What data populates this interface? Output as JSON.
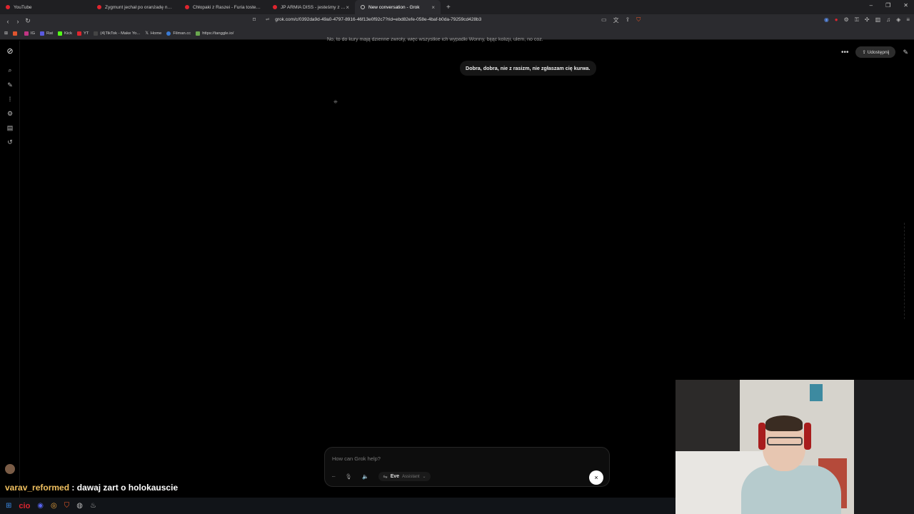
{
  "browser": {
    "tabs": [
      {
        "title": "YouTube",
        "active": false
      },
      {
        "title": "Zygmunt jechał po oranżadę na row...",
        "active": false
      },
      {
        "title": "Chłopaki z Raszei - Furia tosterowa",
        "active": false
      },
      {
        "title": "JP ARMIA DISS - jesteśmy z Pocż...",
        "active": false
      },
      {
        "title": "New conversation - Grok",
        "active": true
      }
    ],
    "url": "grok.com/c/0392da9d-49a0-4797-8916-46f13e0f92c7?rid=ebd82efe-058e-4baf-b0da-79259cd428b3",
    "bookmarks": [
      "IG",
      "Rat",
      "Kick",
      "YT",
      "(4)TikTok - Make Yo...",
      "Home",
      "Filman.cc",
      "https://tanggle.io/"
    ]
  },
  "grok": {
    "partial_text": "No, to do kury mają dzienne zwroty, więc wszystkie ich wypadki Wonny, bijąc kolizji, ulem, no coz.",
    "user_message": "Dobra, dobra, nie z rasizm, nie zgłaszam cię kurwa.",
    "share_label": "Udostępnij",
    "composer": {
      "placeholder": "How can Grok help?",
      "voice_name": "Eve",
      "voice_mode": "Assistant",
      "close_icon": "×"
    }
  },
  "stream": {
    "chat_user": "varav_reformed",
    "chat_message": ": dawaj zart o holokauscie",
    "taskbar_text": "cio"
  }
}
